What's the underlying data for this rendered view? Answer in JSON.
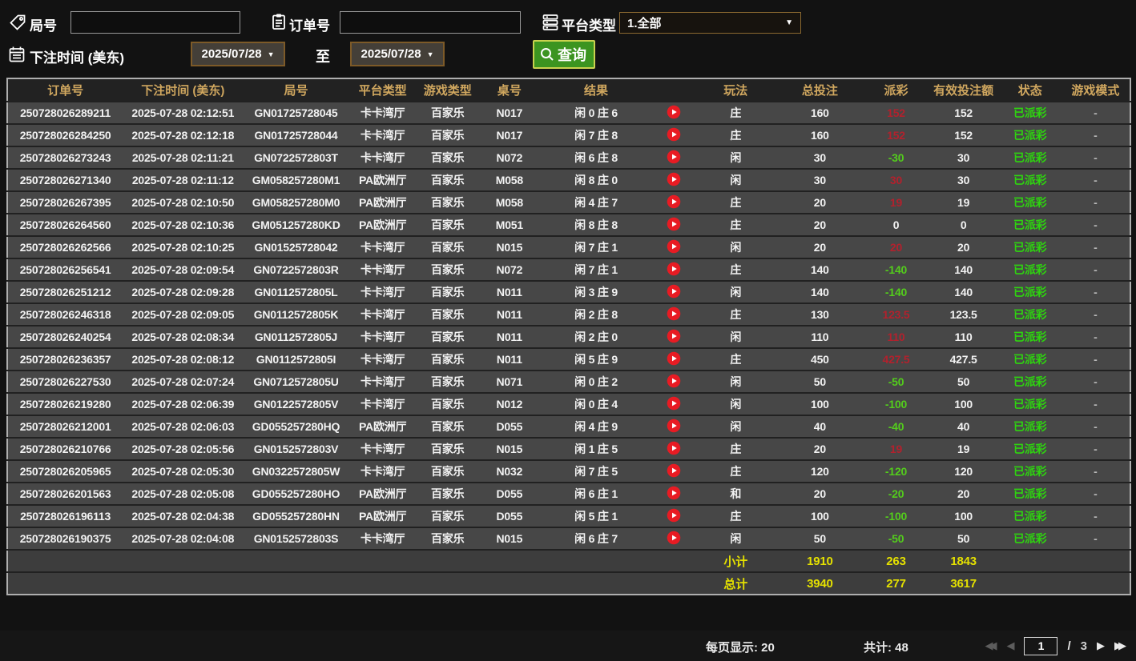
{
  "filters": {
    "game_no_label": "局号",
    "game_no_value": "",
    "order_no_label": "订单号",
    "order_no_value": "",
    "platform_type_label": "平台类型",
    "platform_selected": "1.全部",
    "bet_time_label": "下注时间 (美东)",
    "date_from": "2025/07/28",
    "to_label": "至",
    "date_to": "2025/07/28",
    "search_label": "查询"
  },
  "table": {
    "columns": [
      "订单号",
      "下注时间 (美东)",
      "局号",
      "平台类型",
      "游戏类型",
      "桌号",
      "结果",
      "",
      "玩法",
      "总投注",
      "派彩",
      "有效投注额",
      "状态",
      "游戏模式"
    ],
    "rows": [
      {
        "order_no": "250728026289211",
        "bet_time": "2025-07-28 02:12:51",
        "game_no": "GN01725728045",
        "platform": "卡卡湾厅",
        "game_type": "百家乐",
        "table_no": "N017",
        "result": "闲 0 庄 6",
        "play": "庄",
        "total_bet": "160",
        "payout": "152",
        "payout_class": "win",
        "valid_bet": "152",
        "status": "已派彩",
        "mode": "-"
      },
      {
        "order_no": "250728026284250",
        "bet_time": "2025-07-28 02:12:18",
        "game_no": "GN01725728044",
        "platform": "卡卡湾厅",
        "game_type": "百家乐",
        "table_no": "N017",
        "result": "闲 7 庄 8",
        "play": "庄",
        "total_bet": "160",
        "payout": "152",
        "payout_class": "win",
        "valid_bet": "152",
        "status": "已派彩",
        "mode": "-"
      },
      {
        "order_no": "250728026273243",
        "bet_time": "2025-07-28 02:11:21",
        "game_no": "GN0722572803T",
        "platform": "卡卡湾厅",
        "game_type": "百家乐",
        "table_no": "N072",
        "result": "闲 6 庄 8",
        "play": "闲",
        "total_bet": "30",
        "payout": "-30",
        "payout_class": "loss",
        "valid_bet": "30",
        "status": "已派彩",
        "mode": "-"
      },
      {
        "order_no": "250728026271340",
        "bet_time": "2025-07-28 02:11:12",
        "game_no": "GM058257280M1",
        "platform": "PA欧洲厅",
        "game_type": "百家乐",
        "table_no": "M058",
        "result": "闲 8 庄 0",
        "play": "闲",
        "total_bet": "30",
        "payout": "30",
        "payout_class": "win",
        "valid_bet": "30",
        "status": "已派彩",
        "mode": "-"
      },
      {
        "order_no": "250728026267395",
        "bet_time": "2025-07-28 02:10:50",
        "game_no": "GM058257280M0",
        "platform": "PA欧洲厅",
        "game_type": "百家乐",
        "table_no": "M058",
        "result": "闲 4 庄 7",
        "play": "庄",
        "total_bet": "20",
        "payout": "19",
        "payout_class": "win",
        "valid_bet": "19",
        "status": "已派彩",
        "mode": "-"
      },
      {
        "order_no": "250728026264560",
        "bet_time": "2025-07-28 02:10:36",
        "game_no": "GM051257280KD",
        "platform": "PA欧洲厅",
        "game_type": "百家乐",
        "table_no": "M051",
        "result": "闲 8 庄 8",
        "play": "庄",
        "total_bet": "20",
        "payout": "0",
        "payout_class": "zero",
        "valid_bet": "0",
        "status": "已派彩",
        "mode": "-"
      },
      {
        "order_no": "250728026262566",
        "bet_time": "2025-07-28 02:10:25",
        "game_no": "GN01525728042",
        "platform": "卡卡湾厅",
        "game_type": "百家乐",
        "table_no": "N015",
        "result": "闲 7 庄 1",
        "play": "闲",
        "total_bet": "20",
        "payout": "20",
        "payout_class": "win",
        "valid_bet": "20",
        "status": "已派彩",
        "mode": "-"
      },
      {
        "order_no": "250728026256541",
        "bet_time": "2025-07-28 02:09:54",
        "game_no": "GN0722572803R",
        "platform": "卡卡湾厅",
        "game_type": "百家乐",
        "table_no": "N072",
        "result": "闲 7 庄 1",
        "play": "庄",
        "total_bet": "140",
        "payout": "-140",
        "payout_class": "loss",
        "valid_bet": "140",
        "status": "已派彩",
        "mode": "-"
      },
      {
        "order_no": "250728026251212",
        "bet_time": "2025-07-28 02:09:28",
        "game_no": "GN0112572805L",
        "platform": "卡卡湾厅",
        "game_type": "百家乐",
        "table_no": "N011",
        "result": "闲 3 庄 9",
        "play": "闲",
        "total_bet": "140",
        "payout": "-140",
        "payout_class": "loss",
        "valid_bet": "140",
        "status": "已派彩",
        "mode": "-"
      },
      {
        "order_no": "250728026246318",
        "bet_time": "2025-07-28 02:09:05",
        "game_no": "GN0112572805K",
        "platform": "卡卡湾厅",
        "game_type": "百家乐",
        "table_no": "N011",
        "result": "闲 2 庄 8",
        "play": "庄",
        "total_bet": "130",
        "payout": "123.5",
        "payout_class": "win",
        "valid_bet": "123.5",
        "status": "已派彩",
        "mode": "-"
      },
      {
        "order_no": "250728026240254",
        "bet_time": "2025-07-28 02:08:34",
        "game_no": "GN0112572805J",
        "platform": "卡卡湾厅",
        "game_type": "百家乐",
        "table_no": "N011",
        "result": "闲 2 庄 0",
        "play": "闲",
        "total_bet": "110",
        "payout": "110",
        "payout_class": "win",
        "valid_bet": "110",
        "status": "已派彩",
        "mode": "-"
      },
      {
        "order_no": "250728026236357",
        "bet_time": "2025-07-28 02:08:12",
        "game_no": "GN0112572805I",
        "platform": "卡卡湾厅",
        "game_type": "百家乐",
        "table_no": "N011",
        "result": "闲 5 庄 9",
        "play": "庄",
        "total_bet": "450",
        "payout": "427.5",
        "payout_class": "win",
        "valid_bet": "427.5",
        "status": "已派彩",
        "mode": "-"
      },
      {
        "order_no": "250728026227530",
        "bet_time": "2025-07-28 02:07:24",
        "game_no": "GN0712572805U",
        "platform": "卡卡湾厅",
        "game_type": "百家乐",
        "table_no": "N071",
        "result": "闲 0 庄 2",
        "play": "闲",
        "total_bet": "50",
        "payout": "-50",
        "payout_class": "loss",
        "valid_bet": "50",
        "status": "已派彩",
        "mode": "-"
      },
      {
        "order_no": "250728026219280",
        "bet_time": "2025-07-28 02:06:39",
        "game_no": "GN0122572805V",
        "platform": "卡卡湾厅",
        "game_type": "百家乐",
        "table_no": "N012",
        "result": "闲 0 庄 4",
        "play": "闲",
        "total_bet": "100",
        "payout": "-100",
        "payout_class": "loss",
        "valid_bet": "100",
        "status": "已派彩",
        "mode": "-"
      },
      {
        "order_no": "250728026212001",
        "bet_time": "2025-07-28 02:06:03",
        "game_no": "GD055257280HQ",
        "platform": "PA欧洲厅",
        "game_type": "百家乐",
        "table_no": "D055",
        "result": "闲 4 庄 9",
        "play": "闲",
        "total_bet": "40",
        "payout": "-40",
        "payout_class": "loss",
        "valid_bet": "40",
        "status": "已派彩",
        "mode": "-"
      },
      {
        "order_no": "250728026210766",
        "bet_time": "2025-07-28 02:05:56",
        "game_no": "GN0152572803V",
        "platform": "卡卡湾厅",
        "game_type": "百家乐",
        "table_no": "N015",
        "result": "闲 1 庄 5",
        "play": "庄",
        "total_bet": "20",
        "payout": "19",
        "payout_class": "win",
        "valid_bet": "19",
        "status": "已派彩",
        "mode": "-"
      },
      {
        "order_no": "250728026205965",
        "bet_time": "2025-07-28 02:05:30",
        "game_no": "GN0322572805W",
        "platform": "卡卡湾厅",
        "game_type": "百家乐",
        "table_no": "N032",
        "result": "闲 7 庄 5",
        "play": "庄",
        "total_bet": "120",
        "payout": "-120",
        "payout_class": "loss",
        "valid_bet": "120",
        "status": "已派彩",
        "mode": "-"
      },
      {
        "order_no": "250728026201563",
        "bet_time": "2025-07-28 02:05:08",
        "game_no": "GD055257280HO",
        "platform": "PA欧洲厅",
        "game_type": "百家乐",
        "table_no": "D055",
        "result": "闲 6 庄 1",
        "play": "和",
        "total_bet": "20",
        "payout": "-20",
        "payout_class": "loss",
        "valid_bet": "20",
        "status": "已派彩",
        "mode": "-"
      },
      {
        "order_no": "250728026196113",
        "bet_time": "2025-07-28 02:04:38",
        "game_no": "GD055257280HN",
        "platform": "PA欧洲厅",
        "game_type": "百家乐",
        "table_no": "D055",
        "result": "闲 5 庄 1",
        "play": "庄",
        "total_bet": "100",
        "payout": "-100",
        "payout_class": "loss",
        "valid_bet": "100",
        "status": "已派彩",
        "mode": "-"
      },
      {
        "order_no": "250728026190375",
        "bet_time": "2025-07-28 02:04:08",
        "game_no": "GN0152572803S",
        "platform": "卡卡湾厅",
        "game_type": "百家乐",
        "table_no": "N015",
        "result": "闲 6 庄 7",
        "play": "闲",
        "total_bet": "50",
        "payout": "-50",
        "payout_class": "loss",
        "valid_bet": "50",
        "status": "已派彩",
        "mode": "-"
      }
    ],
    "subtotal": {
      "label": "小计",
      "total_bet": "1910",
      "payout": "263",
      "valid_bet": "1843"
    },
    "total": {
      "label": "总计",
      "total_bet": "3940",
      "payout": "277",
      "valid_bet": "3617"
    }
  },
  "footer": {
    "per_page_label": "每页显示: 20",
    "total_label": "共计: 48",
    "current_page": "1",
    "page_separator": "/",
    "total_pages": "3"
  }
}
